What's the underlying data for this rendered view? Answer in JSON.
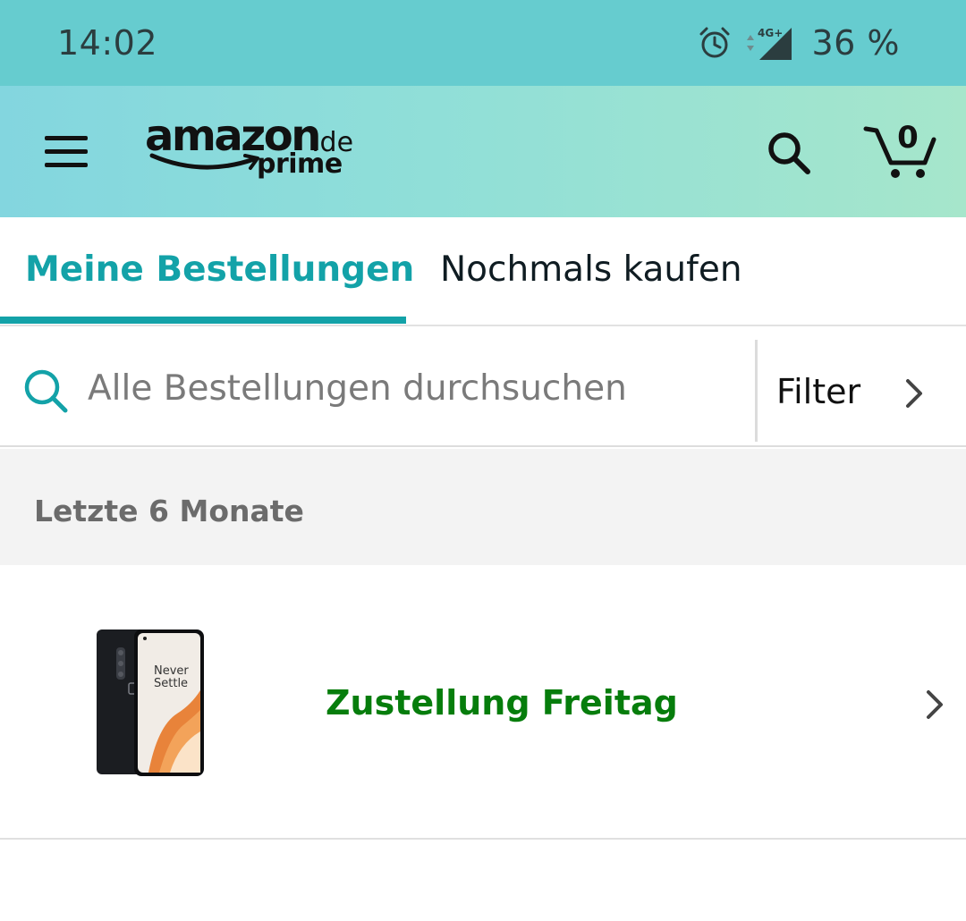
{
  "status_bar": {
    "time": "14:02",
    "network": "4G+",
    "battery": "36 %",
    "icons": [
      "alarm-icon",
      "signal-icon"
    ]
  },
  "header": {
    "logo": {
      "word": "amazon",
      "tld": ".de",
      "sub": "prime"
    },
    "cart_count": "0",
    "icons": [
      "menu-icon",
      "search-icon",
      "cart-icon"
    ],
    "background_gradient": [
      "#83d6df",
      "#a6e6cb"
    ]
  },
  "tabs": [
    {
      "label": "Meine Bestellungen",
      "active": true
    },
    {
      "label": "Nochmals kaufen",
      "active": false
    }
  ],
  "search": {
    "placeholder": "Alle Bestellungen durchsuchen",
    "value": "",
    "filter_label": "Filter"
  },
  "section": {
    "title": "Letzte 6 Monate"
  },
  "orders": [
    {
      "status": "Zustellung Freitag",
      "image_text": [
        "Never",
        "Settle"
      ]
    }
  ],
  "colors": {
    "status_bar": "#66cccf",
    "accent_teal": "#13a2a8",
    "delivery_green": "#067d0c",
    "section_bg": "#f3f3f3"
  }
}
